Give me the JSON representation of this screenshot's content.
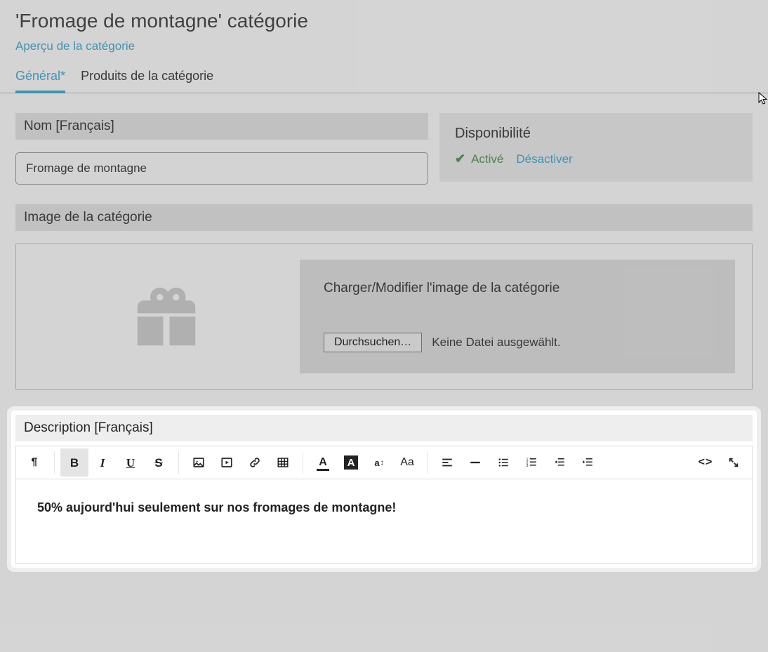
{
  "header": {
    "page_title": "'Fromage de montagne' catégorie",
    "preview_link": "Aperçu de la catégorie"
  },
  "tabs": {
    "general": "Général",
    "general_dirty_marker": "*",
    "products": "Produits de la catégorie"
  },
  "name_section": {
    "label": "Nom [Français]",
    "value": "Fromage de montagne"
  },
  "availability": {
    "title": "Disponibilité",
    "active_label": "Activé",
    "deactivate_label": "Désactiver"
  },
  "image_section": {
    "header": "Image de la catégorie",
    "upload_title": "Charger/Modifier l'image de la catégorie",
    "browse_button": "Durchsuchen…",
    "no_file": "Keine Datei ausgewählt."
  },
  "description": {
    "header": "Description [Français]",
    "content_bold": "50% aujourd'hui seulement sur nos fromages de montagne!"
  },
  "toolbar_icons": {
    "paragraph": "paragraph-format-icon",
    "bold": "B",
    "italic": "I",
    "underline": "U",
    "strike": "S",
    "az": "a",
    "az_arrows": "↕",
    "aa": "Aa",
    "code": "<>"
  }
}
